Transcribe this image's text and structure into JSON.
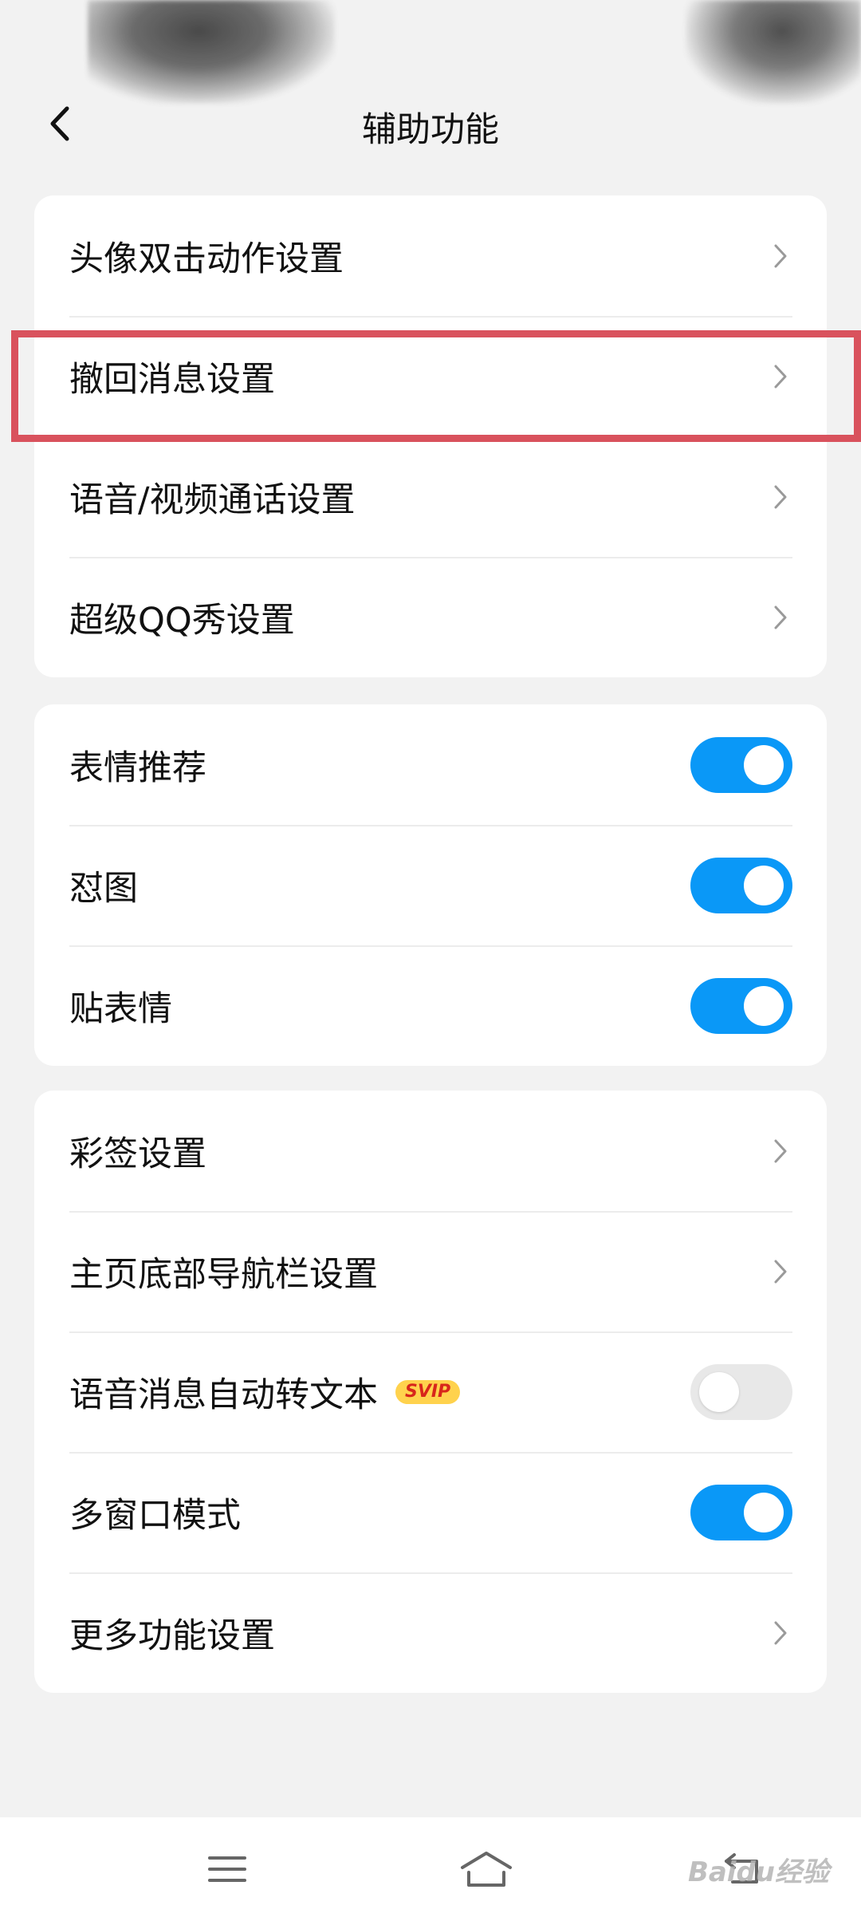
{
  "header": {
    "title": "辅助功能"
  },
  "sections": [
    {
      "items": [
        {
          "label": "头像双击动作设置",
          "type": "link"
        },
        {
          "label": "撤回消息设置",
          "type": "link"
        },
        {
          "label": "语音/视频通话设置",
          "type": "link"
        },
        {
          "label": "超级QQ秀设置",
          "type": "link"
        }
      ]
    },
    {
      "items": [
        {
          "label": "表情推荐",
          "type": "toggle",
          "state": "on"
        },
        {
          "label": "怼图",
          "type": "toggle",
          "state": "on"
        },
        {
          "label": "贴表情",
          "type": "toggle",
          "state": "on"
        }
      ]
    },
    {
      "items": [
        {
          "label": "彩签设置",
          "type": "link"
        },
        {
          "label": "主页底部导航栏设置",
          "type": "link"
        },
        {
          "label": "语音消息自动转文本",
          "type": "toggle",
          "state": "off",
          "badge": "SVIP"
        },
        {
          "label": "多窗口模式",
          "type": "toggle",
          "state": "on"
        },
        {
          "label": "更多功能设置",
          "type": "link"
        }
      ]
    }
  ],
  "colors": {
    "toggle_on": "#0a98f7",
    "highlight": "#d9525d",
    "badge": "#ffd24d"
  },
  "navbar": {
    "icons": [
      "menu-icon",
      "home-icon",
      "back-icon"
    ]
  },
  "watermark": "Baidu经验"
}
